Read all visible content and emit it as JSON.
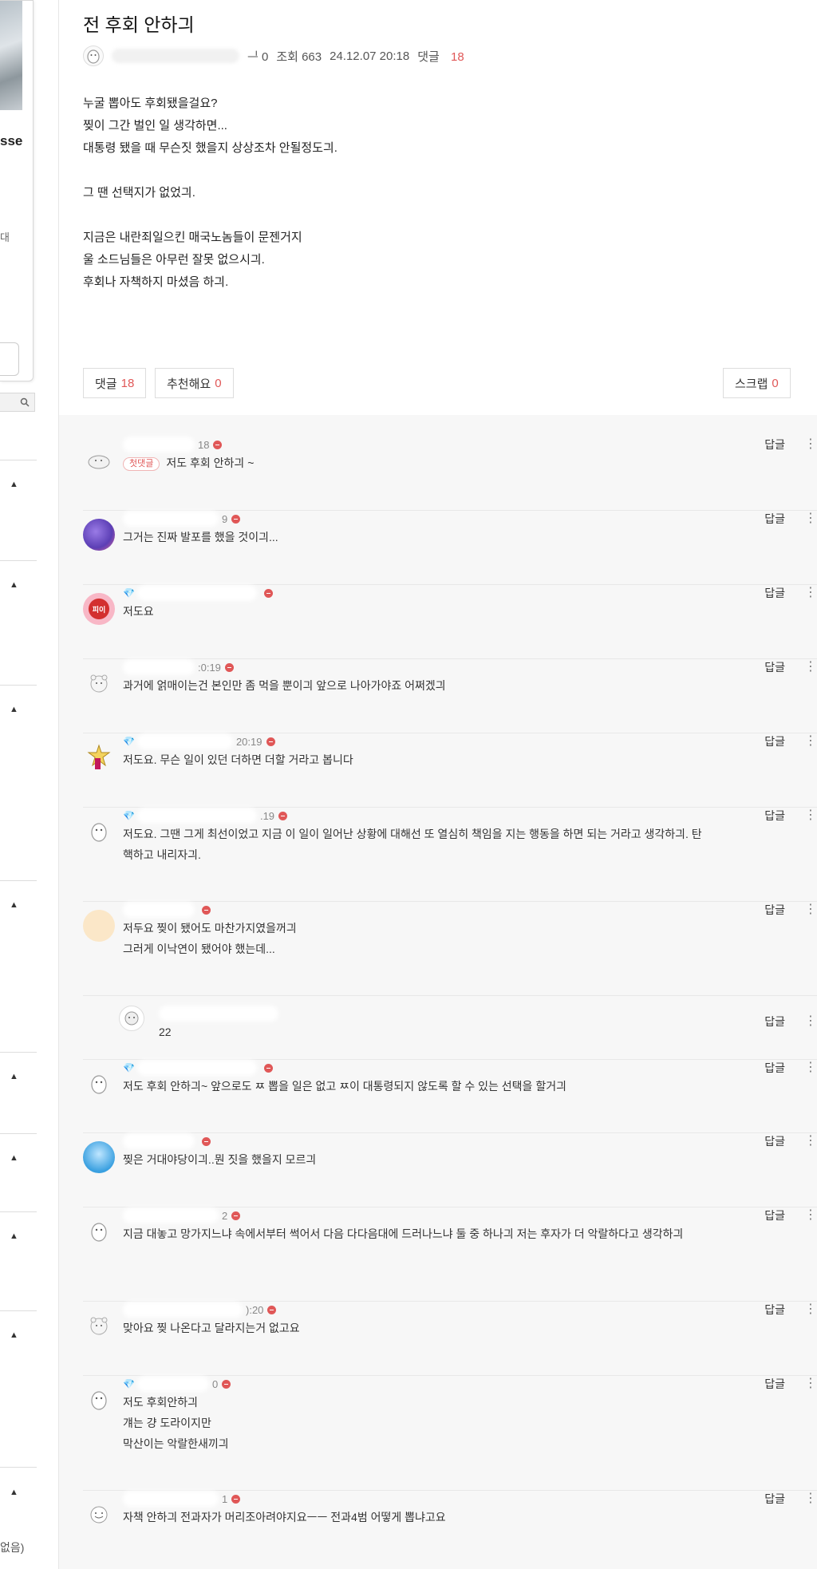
{
  "sidebar": {
    "partial_text_large": "sse",
    "partial_text_small": "대",
    "search_icon": "search-icon",
    "arrow_glyph": "▲",
    "footer_partial": "없음)"
  },
  "post": {
    "title": "전 후회 안하긔",
    "meta": {
      "partial": "ᆜ 0",
      "views_label": "조회 663",
      "datetime": "24.12.07 20:18",
      "comments_label": "댓글",
      "comments_count": "18"
    },
    "body": [
      "누굴 뽑아도 후회됐을걸요?",
      "찢이 그간 벌인 일 생각하면...",
      "대통령 됐을 때 무슨짓 했을지 상상조차 안될정도긔.",
      "",
      "그 땐 선택지가 없었긔.",
      "",
      "지금은 내란죄일으킨 매국노놈들이 문젠거지",
      "울 소드님들은 아무런 잘못 없으시긔.",
      "후회나 자책하지 마셨음 하긔."
    ],
    "actions": {
      "comment_label": "댓글",
      "comment_count": "18",
      "like_label": "추천해요",
      "like_count": "0",
      "scrap_label": "스크랩",
      "scrap_count": "0"
    }
  },
  "comments": {
    "reply_label": "답글",
    "items": [
      {
        "meta": "18",
        "tag": "첫댓글",
        "text": "저도 후회 안하긔 ~",
        "avatar": "seal-avatar-icon"
      },
      {
        "meta": "9",
        "text": "그거는 진짜 발포를 했을 것이긔...",
        "avatar": "purple-avatar"
      },
      {
        "meta": "",
        "gem": "💎",
        "text": "저도요",
        "avatar": "heart-avatar",
        "avatar_text": "피이"
      },
      {
        "meta": ":0:19",
        "text": "과거에 얽매이는건 본인만 좀 먹을 뿐이긔 앞으로 나아가야죠 어쩌겠긔",
        "avatar": "bear-avatar-icon"
      },
      {
        "meta": "20:19",
        "gem": "💎",
        "text": "저도요. 무슨 일이 있던 더하면 더할 거라고 봅니다",
        "avatar": "star-avatar-icon"
      },
      {
        "meta": ".19",
        "gem": "💎",
        "text": "저도요. 그땐 그게 최선이었고 지금 이 일이 일어난 상황에 대해선 또 열심히 책임을 지는 행동을 하면 되는 거라고 생각하긔. 탄핵하고 내리자긔.",
        "avatar": "penguin-avatar-icon"
      },
      {
        "meta": "",
        "text": "저두요 찢이 됐어도 마찬가지였을꺼긔\n그러게 이낙연이 됐어야 했는데...",
        "avatar": "beige-avatar"
      },
      {
        "meta": "",
        "text": "22",
        "avatar": "small-seal-avatar-icon",
        "nested": true
      },
      {
        "meta": "",
        "gem": "💎",
        "text": "저도 후회 안하긔~ 앞으로도 ㅉ 뽑을 일은 없고 ㅉ이 대통령되지 않도록 할 수 있는 선택을 할거긔",
        "avatar": "penguin-avatar-icon"
      },
      {
        "meta": "",
        "text": "찢은 거대야당이긔..뭔 짓을 했을지 모르긔",
        "avatar": "blue-character-avatar"
      },
      {
        "meta": "2",
        "text": "지금 대놓고 망가지느냐 속에서부터 썩어서 다음 다다음대에 드러나느냐 둘 중 하나긔 저는 후자가 더 악랄하다고 생각하긔",
        "avatar": "penguin-avatar-icon"
      },
      {
        "meta": "):20",
        "text": "맞아요 찢 나온다고 달라지는거 없고요",
        "avatar": "bear-avatar-icon"
      },
      {
        "meta": "0",
        "gem": "💎",
        "text": "저도 후회안하긔\n걔는 걍 도라이지만\n막산이는 악랄한새끼긔",
        "avatar": "penguin-avatar-icon"
      },
      {
        "meta": "1",
        "text": "자책 안하긔 전과자가 머리조아려야지요ㅡㅡ 전과4범 어떻게 뽑냐고요",
        "avatar": "ghost-avatar-icon"
      }
    ]
  },
  "colors": {
    "accent": "#e05757",
    "comment_bg": "#f7f7f7",
    "gem": "#4aa3df"
  }
}
